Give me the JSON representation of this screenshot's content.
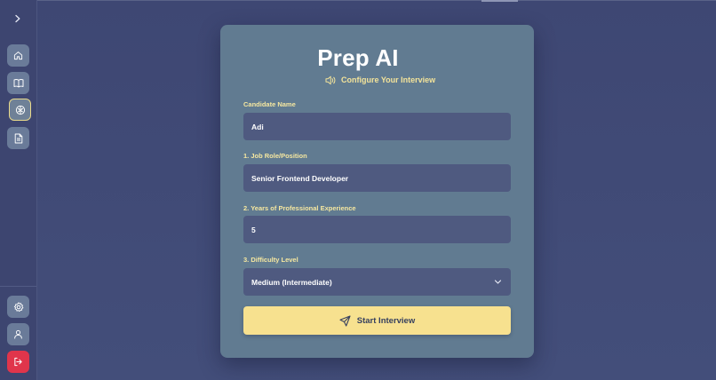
{
  "app": {
    "title": "Prep AI",
    "subtitle": "Configure Your Interview"
  },
  "sidebar": {
    "toggle_icon": "chevron-right-icon",
    "top_items": [
      {
        "name": "home",
        "icon": "home-icon"
      },
      {
        "name": "library",
        "icon": "book-open-icon"
      },
      {
        "name": "interview",
        "icon": "brain-icon",
        "active": true
      },
      {
        "name": "documents",
        "icon": "file-text-icon"
      }
    ],
    "bottom_items": [
      {
        "name": "settings",
        "icon": "gear-icon"
      },
      {
        "name": "profile",
        "icon": "user-icon"
      },
      {
        "name": "logout",
        "icon": "logout-icon"
      }
    ]
  },
  "form": {
    "candidate": {
      "label": "Candidate Name",
      "value": "Adi"
    },
    "job_role": {
      "label": "1. Job Role/Position",
      "value": "Senior Frontend Developer"
    },
    "experience": {
      "label": "2. Years of Professional Experience",
      "value": "5"
    },
    "difficulty": {
      "label": "3. Difficulty Level",
      "value": "Medium (Intermediate)"
    },
    "submit_label": "Start Interview"
  },
  "colors": {
    "background": "#3e4773",
    "card": "#617b91",
    "input": "#4f5a80",
    "accent_yellow": "#f7e18f",
    "label_yellow": "#f5e7a0",
    "logout_red": "#e0354b"
  }
}
